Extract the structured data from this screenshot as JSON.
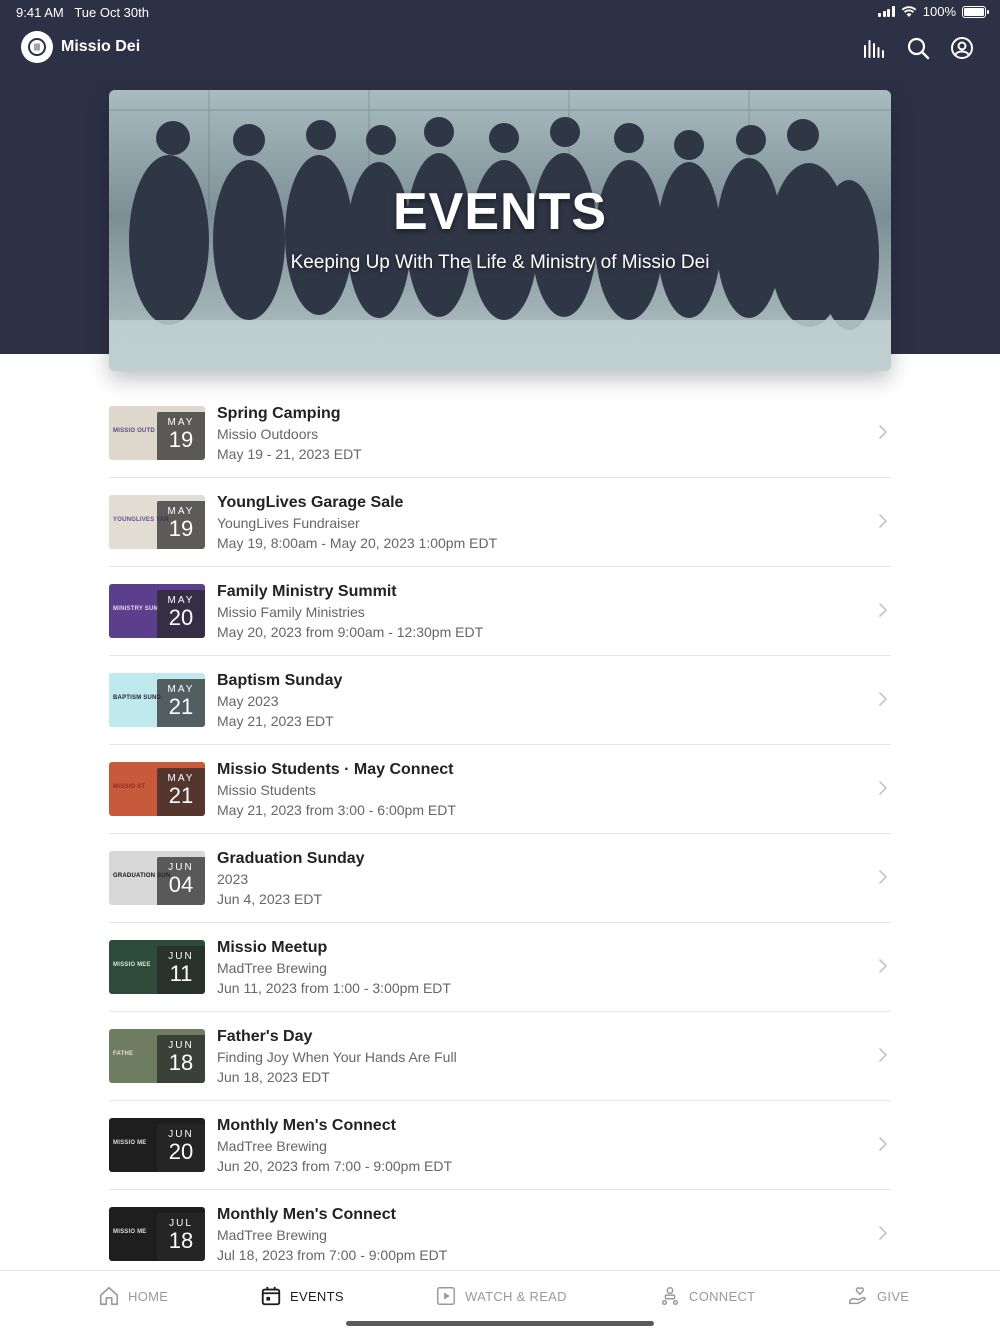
{
  "status": {
    "time": "9:41 AM",
    "date": "Tue Oct 30th",
    "battery": "100%"
  },
  "app": {
    "title": "Missio Dei"
  },
  "header_icons": [
    "bars-icon",
    "search-icon",
    "profile-icon"
  ],
  "hero": {
    "title": "EVENTS",
    "subtitle": "Keeping Up With The Life & Ministry of Missio Dei"
  },
  "events": [
    {
      "title": "Spring Camping",
      "subtitle": "Missio Outdoors",
      "date": "May 19 - 21, 2023 EDT",
      "month": "MAY",
      "day": "19",
      "thumb_bg": "#ddd7cc",
      "thumb_color": "#5a4a8a",
      "thumb_text": "MISSIO OUTD"
    },
    {
      "title": "YoungLives Garage Sale",
      "subtitle": "YoungLives Fundraiser",
      "date": "May 19, 8:00am - May 20, 2023 1:00pm EDT",
      "month": "MAY",
      "day": "19",
      "thumb_bg": "#e2ddd2",
      "thumb_color": "#6a4a9a",
      "thumb_text": "YOUNGLIVES YAR"
    },
    {
      "title": "Family Ministry Summit",
      "subtitle": "Missio Family Ministries",
      "date": "May 20, 2023 from 9:00am - 12:30pm EDT",
      "month": "MAY",
      "day": "20",
      "thumb_bg": "#5b3f8c",
      "thumb_color": "#e0d8f0",
      "thumb_text": "MINISTRY SUM"
    },
    {
      "title": "Baptism Sunday",
      "subtitle": "May 2023",
      "date": "May 21, 2023 EDT",
      "month": "MAY",
      "day": "21",
      "thumb_bg": "#bfe9ec",
      "thumb_color": "#223",
      "thumb_text": "BAPTISM SUND"
    },
    {
      "title": "Missio Students · May Connect",
      "subtitle": "Missio Students",
      "date": "May 21, 2023 from 3:00 - 6:00pm EDT",
      "month": "MAY",
      "day": "21",
      "thumb_bg": "#c85a3c",
      "thumb_color": "#8a2a20",
      "thumb_text": "MISSIO ST"
    },
    {
      "title": "Graduation Sunday",
      "subtitle": "2023",
      "date": "Jun 4, 2023 EDT",
      "month": "JUN",
      "day": "04",
      "thumb_bg": "#d8d8d8",
      "thumb_color": "#111",
      "thumb_text": "GRADUATION SUN"
    },
    {
      "title": "Missio Meetup",
      "subtitle": "MadTree Brewing",
      "date": "Jun 11, 2023 from 1:00 - 3:00pm EDT",
      "month": "JUN",
      "day": "11",
      "thumb_bg": "#2d4a3a",
      "thumb_color": "#d8e4d8",
      "thumb_text": "MISSIO MEE"
    },
    {
      "title": "Father's Day",
      "subtitle": "Finding Joy When Your Hands Are Full",
      "date": "Jun 18, 2023 EDT",
      "month": "JUN",
      "day": "18",
      "thumb_bg": "#6e7d62",
      "thumb_color": "#e6dfc6",
      "thumb_text": "FATHE"
    },
    {
      "title": "Monthly Men's Connect",
      "subtitle": "MadTree Brewing",
      "date": "Jun 20, 2023 from 7:00 - 9:00pm EDT",
      "month": "JUN",
      "day": "20",
      "thumb_bg": "#1e1e1e",
      "thumb_color": "#ddd",
      "thumb_text": "MISSIO ME"
    },
    {
      "title": "Monthly Men's Connect",
      "subtitle": "MadTree Brewing",
      "date": "Jul 18, 2023 from 7:00 - 9:00pm EDT",
      "month": "JUL",
      "day": "18",
      "thumb_bg": "#1e1e1e",
      "thumb_color": "#ddd",
      "thumb_text": "MISSIO ME"
    }
  ],
  "tabs": [
    {
      "label": "HOME",
      "icon": "home-icon",
      "active": false
    },
    {
      "label": "EVENTS",
      "icon": "calendar-icon",
      "active": true
    },
    {
      "label": "WATCH & READ",
      "icon": "play-icon",
      "active": false
    },
    {
      "label": "CONNECT",
      "icon": "connect-icon",
      "active": false
    },
    {
      "label": "GIVE",
      "icon": "give-icon",
      "active": false
    }
  ]
}
